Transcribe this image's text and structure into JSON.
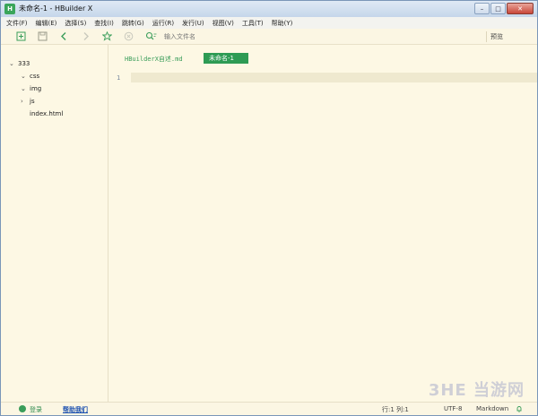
{
  "window": {
    "title": "未命名-1 - HBuilder X",
    "app_icon": "H",
    "controls": {
      "minimize": "–",
      "maximize": "□",
      "close": "✕"
    }
  },
  "menu": [
    "文件(F)",
    "编辑(E)",
    "选择(S)",
    "查找(I)",
    "跳转(G)",
    "运行(R)",
    "发行(U)",
    "视图(V)",
    "工具(T)",
    "帮助(Y)"
  ],
  "toolbar": {
    "search_placeholder": "输入文件名",
    "preview_label": "预览"
  },
  "sidebar": {
    "project": "333",
    "items": [
      {
        "name": "css",
        "expanded": true
      },
      {
        "name": "img",
        "expanded": true
      },
      {
        "name": "js",
        "expanded": false
      },
      {
        "name": "index.html"
      }
    ]
  },
  "editor": {
    "tabs": [
      {
        "label": "HBuilderX自述.md",
        "active": false
      },
      {
        "label": "未命名-1",
        "active": true
      }
    ],
    "line_number": "1"
  },
  "statusbar": {
    "login": "登录",
    "help": "帮助我们",
    "position": "行:1  列:1",
    "encoding": "UTF-8",
    "language": "Markdown"
  },
  "watermark": "3HE 当游网",
  "colors": {
    "accent": "#2e9b54",
    "background": "#fdf8e4"
  }
}
